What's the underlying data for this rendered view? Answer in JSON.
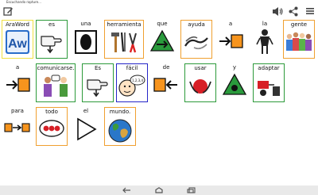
{
  "status_bar": {
    "text": "Escuchando rapture..."
  },
  "app_bar": {
    "icons": [
      "edit-icon",
      "volume-icon",
      "share-icon",
      "menu-icon"
    ]
  },
  "cards": [
    {
      "label": "AraWord",
      "border": "blue",
      "pictogram": "araword-logo"
    },
    {
      "label": "es",
      "border": "green",
      "pictogram": "hand-pointing-down"
    },
    {
      "label": "una",
      "border": "none",
      "pictogram": "one-circle-in-box"
    },
    {
      "label": "herramienta",
      "border": "orange",
      "pictogram": "tools"
    },
    {
      "label": "que",
      "border": "none",
      "pictogram": "triangle-with-arrow"
    },
    {
      "label": "ayuda",
      "border": "orange",
      "pictogram": "helping-hands"
    },
    {
      "label": "a",
      "border": "none",
      "pictogram": "arrow-to-square"
    },
    {
      "label": "la",
      "border": "none",
      "pictogram": "female-figure"
    },
    {
      "label": "gente",
      "border": "orange",
      "pictogram": "group-of-people"
    },
    {
      "label": "a",
      "border": "none",
      "pictogram": "arrow-to-square"
    },
    {
      "label": "comunicarse.",
      "border": "green",
      "pictogram": "two-people-talking"
    },
    {
      "label": "Es",
      "border": "green",
      "pictogram": "hand-pointing-down"
    },
    {
      "label": "fácil",
      "border": "blue",
      "pictogram": "face-with-numbers",
      "pictogram_text": "1,2,3,4"
    },
    {
      "label": "de",
      "border": "none",
      "pictogram": "arrow-from-square"
    },
    {
      "label": "usar",
      "border": "green",
      "pictogram": "hands-holding-red"
    },
    {
      "label": "y",
      "border": "none",
      "pictogram": "triangle-plus"
    },
    {
      "label": "adaptar",
      "border": "green",
      "pictogram": "adapt-objects"
    },
    {
      "label": "para",
      "border": "none",
      "pictogram": "square-arrow-square"
    },
    {
      "label": "todo",
      "border": "orange",
      "pictogram": "three-red-dots"
    },
    {
      "label": "el",
      "border": "none",
      "pictogram": "outline-triangle"
    },
    {
      "label": "mundo.",
      "border": "orange",
      "pictogram": "globe"
    }
  ],
  "nav_bar": {
    "icons": [
      "back-icon",
      "home-icon",
      "recent-apps-icon"
    ]
  },
  "colors": {
    "blue": "#2525c8",
    "orange": "#f0a030",
    "green": "#2c9a3a",
    "yellow": "#f0e040"
  }
}
